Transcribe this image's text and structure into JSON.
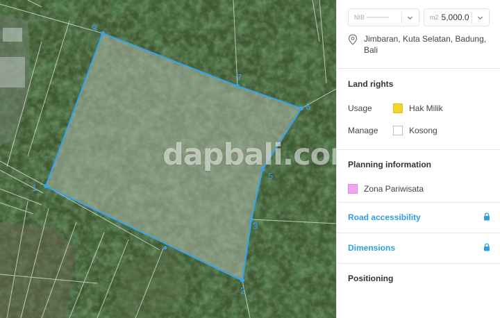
{
  "map": {
    "watermark": "dapbali.com",
    "vertices": [
      "1",
      "2",
      "3",
      "5",
      "6",
      "7",
      "9"
    ],
    "colors": {
      "parcel_outline": "#3aa2e6",
      "parcel_fill": "rgba(175,185,170,0.55)"
    }
  },
  "panel": {
    "nib_label": "NIB",
    "area_unit": "m2",
    "area_value": "5,000.0",
    "location": "Jimbaran, Kuta Selatan, Badung, Bali",
    "land_rights": {
      "title": "Land rights",
      "usage_label": "Usage",
      "usage_value": "Hak Milik",
      "usage_color": "#f5d428",
      "manage_label": "Manage",
      "manage_value": "Kosong",
      "manage_color": "#ffffff"
    },
    "planning": {
      "title": "Planning information",
      "zone": "Zona Pariwisata",
      "zone_color": "#f2a3ee"
    },
    "road_accessibility": "Road accessibility",
    "dimensions": "Dimensions",
    "positioning": "Positioning",
    "accent_color": "#2e9ee2"
  }
}
